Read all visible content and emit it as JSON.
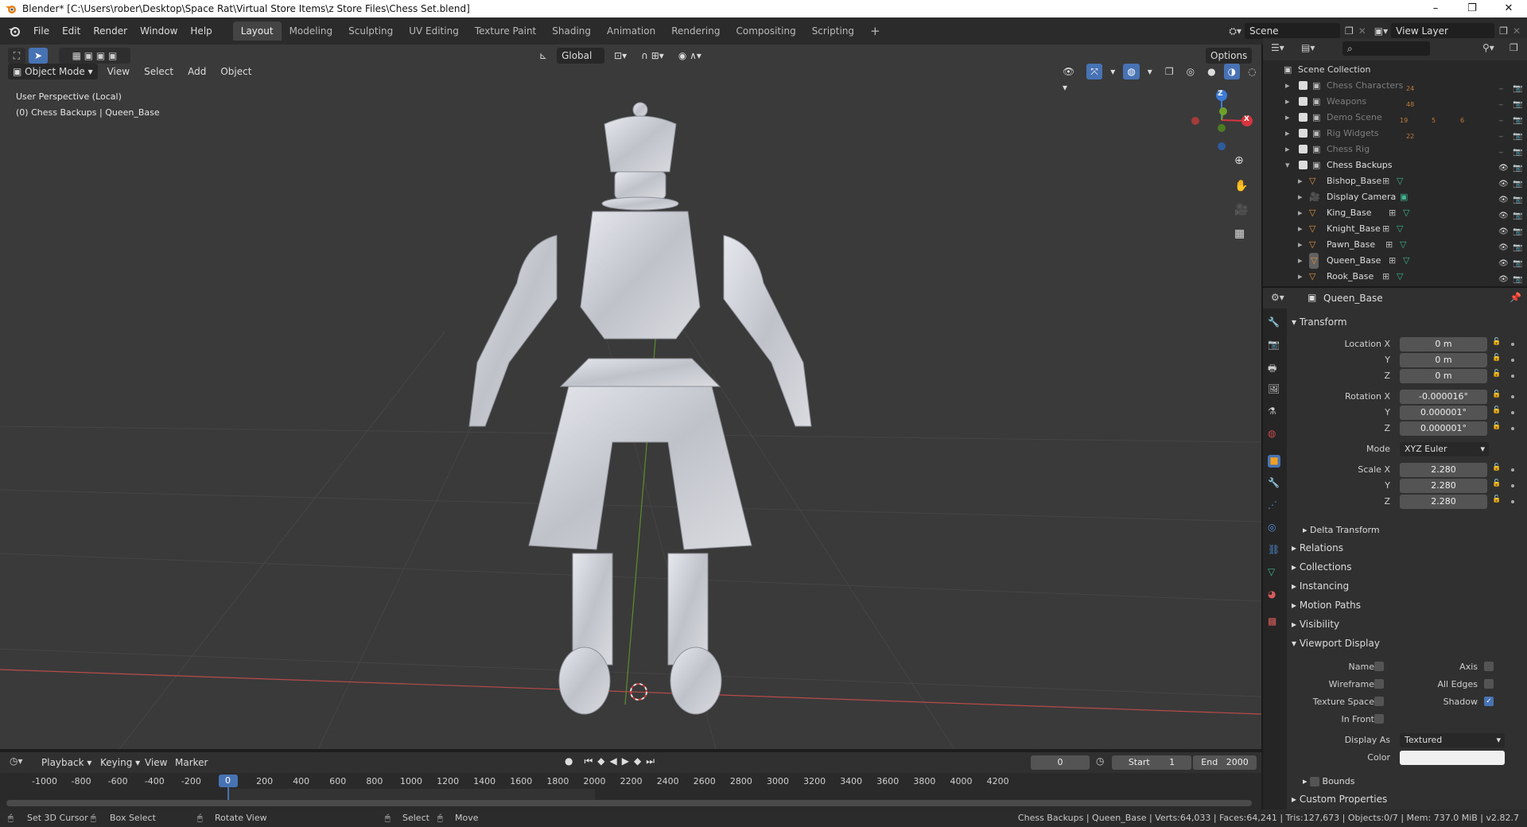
{
  "title": "Blender* [C:\\Users\\rober\\Desktop\\Space Rat\\Virtual Store Items\\z Store Files\\Chess Set.blend]",
  "menu": [
    "File",
    "Edit",
    "Render",
    "Window",
    "Help"
  ],
  "workspaces": [
    "Layout",
    "Modeling",
    "Sculpting",
    "UV Editing",
    "Texture Paint",
    "Shading",
    "Animation",
    "Rendering",
    "Compositing",
    "Scripting"
  ],
  "scene": "Scene",
  "view_layer": "View Layer",
  "viewport": {
    "mode": "Object Mode",
    "menus": [
      "View",
      "Select",
      "Add",
      "Object"
    ],
    "orientation": "Global",
    "options": "Options",
    "overlay_line1": "User Perspective (Local)",
    "overlay_line2": "(0) Chess Backups | Queen_Base",
    "gizmo": {
      "z": "Z",
      "x": "X"
    }
  },
  "outliner": {
    "root": "Scene Collection",
    "collections": [
      {
        "name": "Chess Characters",
        "badge": "24",
        "enabled": false
      },
      {
        "name": "Weapons",
        "badge": "48",
        "enabled": false
      },
      {
        "name": "Demo Scene",
        "badge": "19",
        "badge2": "5",
        "badge3": "6",
        "enabled": false
      },
      {
        "name": "Rig Widgets",
        "badge": "22",
        "enabled": false
      },
      {
        "name": "Chess Rig",
        "badge": "",
        "enabled": false
      },
      {
        "name": "Chess Backups",
        "badge": "",
        "enabled": true
      }
    ],
    "objects": [
      "Bishop_Base",
      "Display Camera",
      "King_Base",
      "Knight_Base",
      "Pawn_Base",
      "Queen_Base",
      "Rook_Base"
    ]
  },
  "properties": {
    "object_name": "Queen_Base",
    "transform_label": "Transform",
    "location": {
      "label": "Location X",
      "x": "0 m",
      "y": "0 m",
      "z": "0 m"
    },
    "rotation": {
      "label": "Rotation X",
      "x": "-0.000016°",
      "y": "0.000001°",
      "z": "0.000001°"
    },
    "mode": {
      "label": "Mode",
      "value": "XYZ Euler"
    },
    "scale": {
      "label": "Scale X",
      "x": "2.280",
      "y": "2.280",
      "z": "2.280"
    },
    "axis_y": "Y",
    "axis_z": "Z",
    "delta": "Delta Transform",
    "sections": [
      "Relations",
      "Collections",
      "Instancing",
      "Motion Paths",
      "Visibility"
    ],
    "viewport_display": "Viewport Display",
    "vd": {
      "name": "Name",
      "axis": "Axis",
      "wireframe": "Wireframe",
      "all_edges": "All Edges",
      "texture_space": "Texture Space",
      "shadow": "Shadow",
      "in_front": "In Front",
      "display_as_label": "Display As",
      "display_as": "Textured",
      "color": "Color"
    },
    "bounds": "Bounds",
    "custom": "Custom Properties"
  },
  "timeline": {
    "menus": [
      "Playback",
      "Keying",
      "View",
      "Marker"
    ],
    "frame": "0",
    "start_label": "Start",
    "start": "1",
    "end_label": "End",
    "end": "2000",
    "ticks": [
      "-1000",
      "-800",
      "-600",
      "-400",
      "-200",
      "0",
      "200",
      "400",
      "600",
      "800",
      "1000",
      "1200",
      "1400",
      "1600",
      "1800",
      "2000",
      "2200",
      "2400",
      "2600",
      "2800",
      "3000",
      "3200",
      "3400",
      "3600",
      "3800",
      "4000",
      "4200"
    ],
    "current": "0"
  },
  "status": {
    "left": [
      "Set 3D Cursor",
      "Box Select",
      "Rotate View",
      "Select",
      "Move"
    ],
    "right": "Chess Backups | Queen_Base | Verts:64,033 | Faces:64,241 | Tris:127,673 | Objects:0/7 | Mem: 737.0 MiB | v2.82.7"
  },
  "colors": {
    "accent": "#4772b3",
    "bg": "#3a3a3a",
    "x_axis": "#d6353e",
    "y_axis": "#6fa02a",
    "z_axis": "#3d7ad6"
  }
}
